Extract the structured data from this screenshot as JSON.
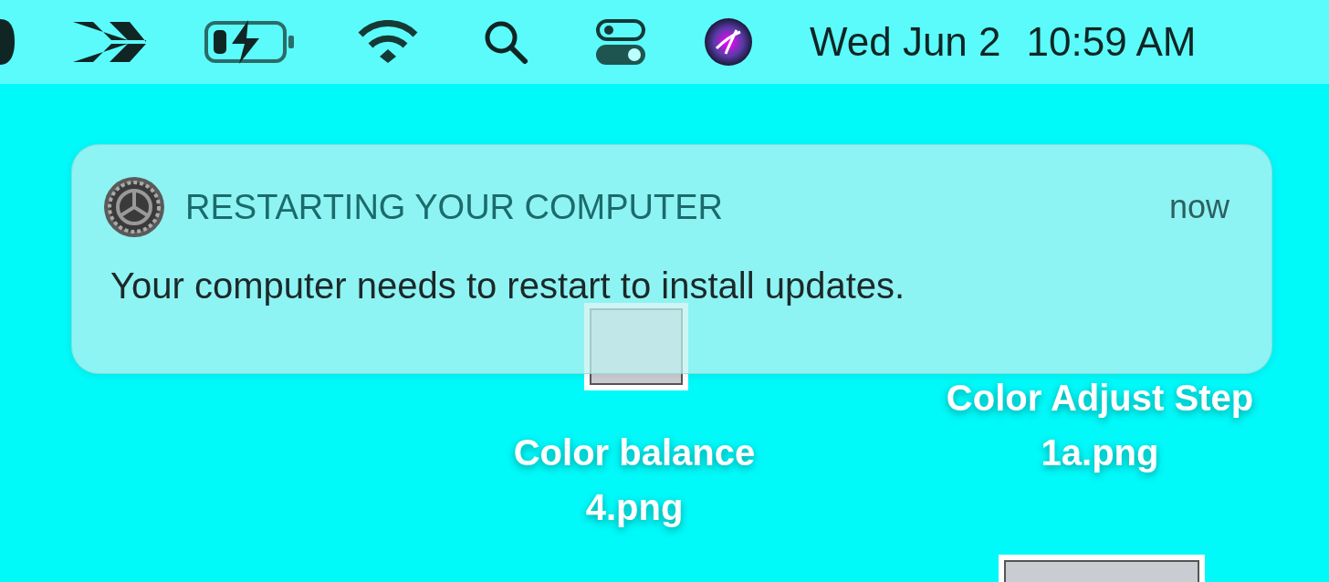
{
  "menu_bar": {
    "date": "Wed Jun 2",
    "time": "10:59 AM"
  },
  "notification": {
    "app_title": "RESTARTING YOUR COMPUTER",
    "time": "now",
    "body": "Your computer needs to restart to install updates."
  },
  "desktop_icons": [
    {
      "kind": "file",
      "lines": [
        "Color balance",
        "4.png"
      ]
    },
    {
      "kind": "file",
      "lines": [
        "Color Adjust Step",
        "1a.png"
      ]
    },
    {
      "kind": "thumbnail"
    }
  ]
}
